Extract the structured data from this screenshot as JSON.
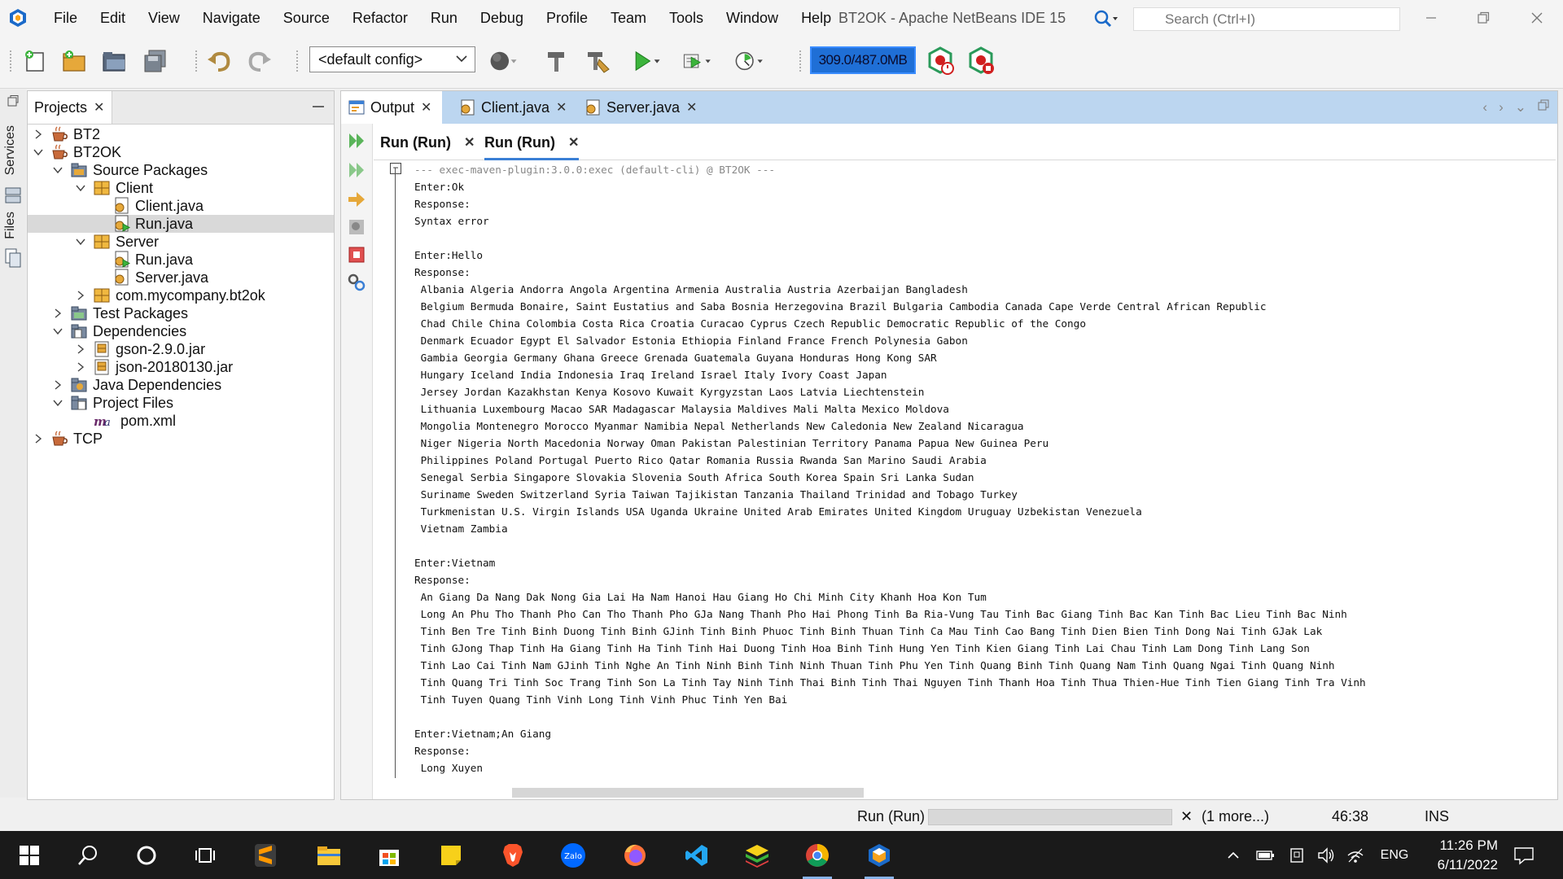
{
  "menu": [
    "File",
    "Edit",
    "View",
    "Navigate",
    "Source",
    "Refactor",
    "Run",
    "Debug",
    "Profile",
    "Team",
    "Tools",
    "Window",
    "Help"
  ],
  "window_title": "BT2OK - Apache NetBeans IDE 15",
  "search": {
    "placeholder": "Search (Ctrl+I)"
  },
  "toolbar": {
    "config": "<default config>",
    "memory": "309.0/487.0MB"
  },
  "side_tabs": {
    "services": "Services",
    "files": "Files"
  },
  "projects": {
    "tab_label": "Projects",
    "tree": [
      {
        "label": "BT2",
        "level": 0,
        "expand": "closed",
        "icon": "coffee-cup-icon"
      },
      {
        "label": "BT2OK",
        "level": 0,
        "expand": "open",
        "icon": "coffee-cup-icon"
      },
      {
        "label": "Source Packages",
        "level": 1,
        "expand": "open",
        "icon": "source-packages-icon"
      },
      {
        "label": "Client",
        "level": 2,
        "expand": "open",
        "icon": "package-icon"
      },
      {
        "label": "Client.java",
        "level": 3,
        "expand": "none",
        "icon": "java-file-icon"
      },
      {
        "label": "Run.java",
        "level": 3,
        "expand": "none",
        "icon": "java-run-file-icon",
        "selected": true
      },
      {
        "label": "Server",
        "level": 2,
        "expand": "open",
        "icon": "package-icon"
      },
      {
        "label": "Run.java",
        "level": 3,
        "expand": "none",
        "icon": "java-run-file-icon"
      },
      {
        "label": "Server.java",
        "level": 3,
        "expand": "none",
        "icon": "java-file-icon"
      },
      {
        "label": "com.mycompany.bt2ok",
        "level": 2,
        "expand": "closed",
        "icon": "package-icon"
      },
      {
        "label": "Test Packages",
        "level": 1,
        "expand": "closed",
        "icon": "test-packages-icon"
      },
      {
        "label": "Dependencies",
        "level": 1,
        "expand": "open",
        "icon": "dependencies-icon"
      },
      {
        "label": "gson-2.9.0.jar",
        "level": 2,
        "expand": "closed",
        "icon": "jar-icon"
      },
      {
        "label": "json-20180130.jar",
        "level": 2,
        "expand": "closed",
        "icon": "jar-icon"
      },
      {
        "label": "Java Dependencies",
        "level": 1,
        "expand": "closed",
        "icon": "java-dependencies-icon"
      },
      {
        "label": "Project Files",
        "level": 1,
        "expand": "open",
        "icon": "project-files-icon"
      },
      {
        "label": "pom.xml",
        "level": 2,
        "expand": "none",
        "icon": "maven-pom-icon"
      },
      {
        "label": "TCP",
        "level": 0,
        "expand": "closed",
        "icon": "coffee-cup-icon"
      }
    ]
  },
  "editor_tabs": [
    {
      "label": "Output",
      "active": true,
      "icon": "output-window-icon"
    },
    {
      "label": "Client.java",
      "active": false,
      "icon": "java-file-icon"
    },
    {
      "label": "Server.java",
      "active": false,
      "icon": "java-file-icon"
    }
  ],
  "run_tabs": [
    {
      "label": "Run (Run)",
      "active": false
    },
    {
      "label": "Run (Run)",
      "active": true
    }
  ],
  "console_lines": [
    "--- exec-maven-plugin:3.0.0:exec (default-cli) @ BT2OK ---",
    "Enter:Ok",
    "Response:",
    "Syntax error",
    "",
    "Enter:Hello",
    "Response:",
    " Albania Algeria Andorra Angola Argentina Armenia Australia Austria Azerbaijan Bangladesh",
    " Belgium Bermuda Bonaire, Saint Eustatius and Saba Bosnia Herzegovina Brazil Bulgaria Cambodia Canada Cape Verde Central African Republic",
    " Chad Chile China Colombia Costa Rica Croatia Curacao Cyprus Czech Republic Democratic Republic of the Congo",
    " Denmark Ecuador Egypt El Salvador Estonia Ethiopia Finland France French Polynesia Gabon",
    " Gambia Georgia Germany Ghana Greece Grenada Guatemala Guyana Honduras Hong Kong SAR",
    " Hungary Iceland India Indonesia Iraq Ireland Israel Italy Ivory Coast Japan",
    " Jersey Jordan Kazakhstan Kenya Kosovo Kuwait Kyrgyzstan Laos Latvia Liechtenstein",
    " Lithuania Luxembourg Macao SAR Madagascar Malaysia Maldives Mali Malta Mexico Moldova",
    " Mongolia Montenegro Morocco Myanmar Namibia Nepal Netherlands New Caledonia New Zealand Nicaragua",
    " Niger Nigeria North Macedonia Norway Oman Pakistan Palestinian Territory Panama Papua New Guinea Peru",
    " Philippines Poland Portugal Puerto Rico Qatar Romania Russia Rwanda San Marino Saudi Arabia",
    " Senegal Serbia Singapore Slovakia Slovenia South Africa South Korea Spain Sri Lanka Sudan",
    " Suriname Sweden Switzerland Syria Taiwan Tajikistan Tanzania Thailand Trinidad and Tobago Turkey",
    " Turkmenistan U.S. Virgin Islands USA Uganda Ukraine United Arab Emirates United Kingdom Uruguay Uzbekistan Venezuela",
    " Vietnam Zambia",
    "",
    "Enter:Vietnam",
    "Response:",
    " An Giang Da Nang Dak Nong Gia Lai Ha Nam Hanoi Hau Giang Ho Chi Minh City Khanh Hoa Kon Tum",
    " Long An Phu Tho Thanh Pho Can Tho Thanh Pho GJa Nang Thanh Pho Hai Phong Tinh Ba Ria-Vung Tau Tinh Bac Giang Tinh Bac Kan Tinh Bac Lieu Tinh Bac Ninh",
    " Tinh Ben Tre Tinh Binh Duong Tinh Binh GJinh Tinh Binh Phuoc Tinh Binh Thuan Tinh Ca Mau Tinh Cao Bang Tinh Dien Bien Tinh Dong Nai Tinh GJak Lak",
    " Tinh GJong Thap Tinh Ha Giang Tinh Ha Tinh Tinh Hai Duong Tinh Hoa Binh Tinh Hung Yen Tinh Kien Giang Tinh Lai Chau Tinh Lam Dong Tinh Lang Son",
    " Tinh Lao Cai Tinh Nam GJinh Tinh Nghe An Tinh Ninh Binh Tinh Ninh Thuan Tinh Phu Yen Tinh Quang Binh Tinh Quang Nam Tinh Quang Ngai Tinh Quang Ninh",
    " Tinh Quang Tri Tinh Soc Trang Tinh Son La Tinh Tay Ninh Tinh Thai Binh Tinh Thai Nguyen Tinh Thanh Hoa Tinh Thua Thien-Hue Tinh Tien Giang Tinh Tra Vinh",
    " Tinh Tuyen Quang Tinh Vinh Long Tinh Vinh Phuc Tinh Yen Bai",
    "",
    "Enter:Vietnam;An Giang",
    "Response:",
    " Long Xuyen"
  ],
  "status": {
    "task": "Run (Run)",
    "more": "(1 more...)",
    "position": "46:38",
    "mode": "INS"
  },
  "taskbar": {
    "apps": [
      "windows-start-icon",
      "search-icon",
      "cortana-icon",
      "task-view-icon",
      "sublime-text-icon",
      "file-explorer-icon",
      "microsoft-store-icon",
      "sticky-notes-icon",
      "brave-browser-icon",
      "zalo-icon",
      "firefox-icon",
      "vscode-icon",
      "bluestacks-icon",
      "chrome-icon",
      "netbeans-icon"
    ],
    "language": "ENG",
    "time": "11:26 PM",
    "date": "6/11/2022"
  },
  "colors": {
    "accent": "#3a7fd5",
    "tabbar": "#bcd6f0",
    "memory": "#1f6fd6",
    "taskbar": "#1a1a1a"
  }
}
